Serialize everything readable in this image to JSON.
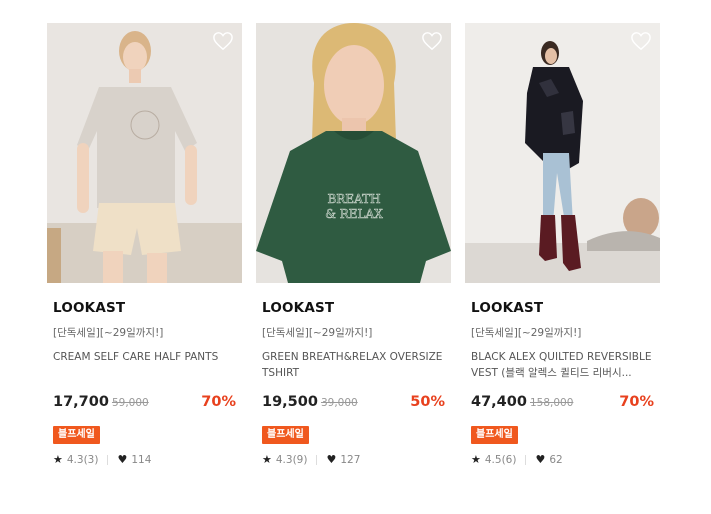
{
  "products": [
    {
      "brand": "LOOKAST",
      "promo": "[단독세일][~29일까지!]",
      "name": "CREAM SELF CARE HALF PANTS",
      "price": "17,700",
      "original_price": "59,000",
      "discount": "70%",
      "badge": "블프세일",
      "rating": "4.3(3)",
      "likes": "114",
      "icons": {
        "star": "star-icon",
        "heart": "heart-filled-icon",
        "wish": "heart-outline-icon"
      }
    },
    {
      "brand": "LOOKAST",
      "promo": "[단독세일][~29일까지!]",
      "name": "GREEN BREATH&RELAX OVERSIZE TSHIRT",
      "price": "19,500",
      "original_price": "39,000",
      "discount": "50%",
      "badge": "블프세일",
      "rating": "4.3(9)",
      "likes": "127",
      "print_text": "BREATH & RELAX",
      "icons": {
        "star": "star-icon",
        "heart": "heart-filled-icon",
        "wish": "heart-outline-icon"
      }
    },
    {
      "brand": "LOOKAST",
      "promo": "[단독세일][~29일까지!]",
      "name": "BLACK ALEX QUILTED REVERSIBLE VEST (블랙 알렉스 퀼티드 리버시...",
      "price": "47,400",
      "original_price": "158,000",
      "discount": "70%",
      "badge": "블프세일",
      "rating": "4.5(6)",
      "likes": "62",
      "icons": {
        "star": "star-icon",
        "heart": "heart-filled-icon",
        "wish": "heart-outline-icon"
      }
    }
  ],
  "colors": {
    "discount": "#e8411e",
    "badge_bg": "#f0581e",
    "text": "#111111",
    "muted": "#888888"
  }
}
